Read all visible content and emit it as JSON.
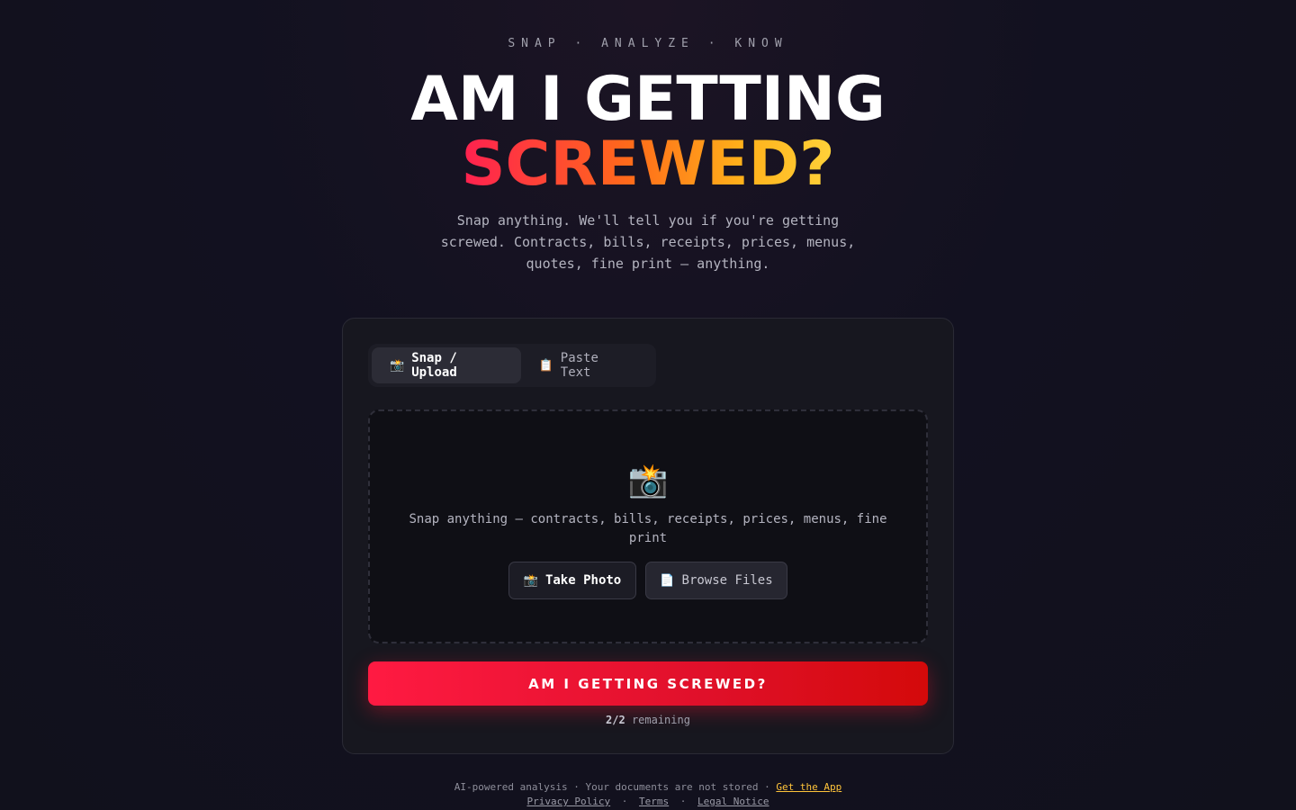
{
  "header": {
    "tagline": "SNAP · ANALYZE · KNOW",
    "title_line1": "AM I GETTING",
    "title_line2": "SCREWED?",
    "subtitle": "Snap anything. We'll tell you if you're getting screwed. Contracts, bills, receipts, prices, menus, quotes, fine print — anything."
  },
  "tabs": [
    {
      "icon": "📸",
      "icon_name": "camera-flash-icon",
      "label": "Snap / Upload",
      "active": true
    },
    {
      "icon": "📋",
      "icon_name": "clipboard-icon",
      "label": "Paste Text",
      "active": false
    }
  ],
  "dropzone": {
    "icon": "📸",
    "icon_name": "camera-flash-icon",
    "text": "Snap anything — contracts, bills, receipts, prices, menus, fine print",
    "take_photo": {
      "icon": "📸",
      "label": "Take Photo"
    },
    "browse_files": {
      "icon": "📄",
      "label": "Browse Files"
    }
  },
  "cta": {
    "label": "AM I GETTING SCREWED?"
  },
  "usage": {
    "count": "2/2",
    "suffix": "remaining"
  },
  "footer": {
    "text": "AI-powered analysis · Your documents are not stored ·",
    "get_app": "Get the App",
    "privacy": "Privacy Policy",
    "terms": "Terms",
    "legal": "Legal Notice",
    "separator": "·"
  },
  "colors": {
    "accent_red": "#ff1a42",
    "accent_orange": "#ff6a1a",
    "accent_yellow": "#ffd23a",
    "background": "#121120",
    "card": "#17171f"
  }
}
